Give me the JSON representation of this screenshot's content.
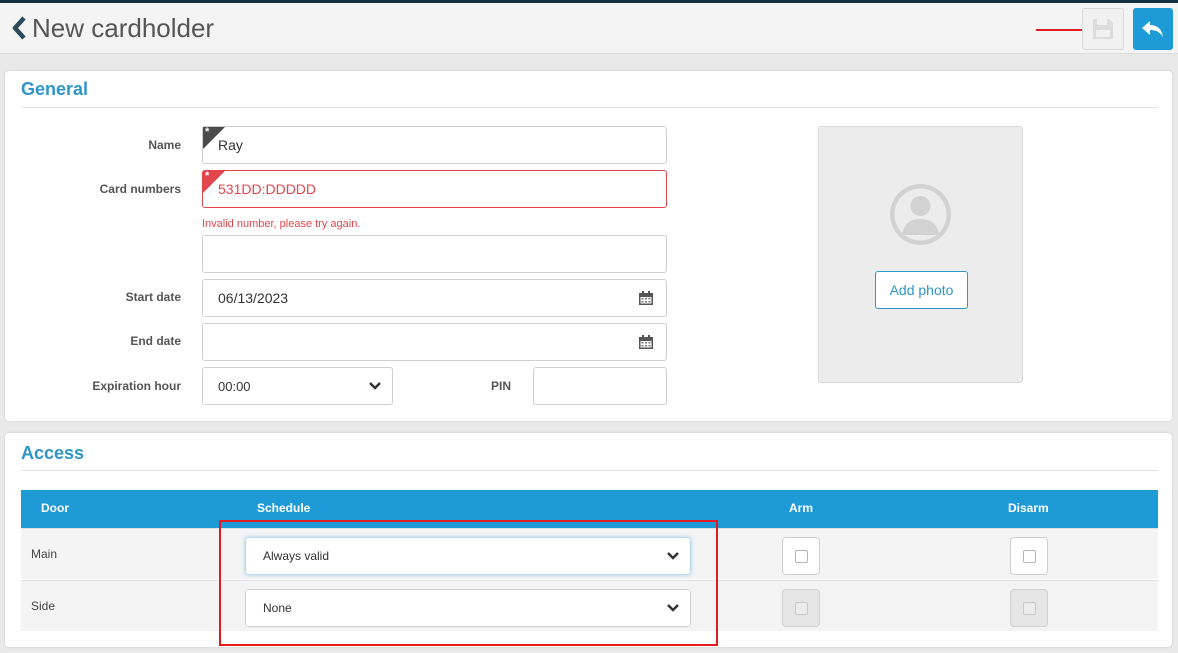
{
  "header": {
    "title": "New cardholder"
  },
  "general": {
    "section_title": "General",
    "name_label": "Name",
    "name_value": "Ray",
    "card_numbers_label": "Card numbers",
    "card_number_1": "531DD:DDDDD",
    "card_number_error": "Invalid number, please try again.",
    "card_number_2": "",
    "start_date_label": "Start date",
    "start_date_value": "06/13/2023",
    "end_date_label": "End date",
    "end_date_value": "",
    "expiration_hour_label": "Expiration hour",
    "expiration_hour_value": "00:00",
    "pin_label": "PIN",
    "pin_value": "",
    "add_photo_label": "Add photo"
  },
  "access": {
    "section_title": "Access",
    "columns": [
      "Door",
      "Schedule",
      "Arm",
      "Disarm"
    ],
    "rows": [
      {
        "door": "Main",
        "schedule": "Always valid",
        "arm": false,
        "disarm": false,
        "enabled": true
      },
      {
        "door": "Side",
        "schedule": "None",
        "arm": false,
        "disarm": false,
        "enabled": false
      }
    ]
  },
  "colors": {
    "accent": "#1e9ad6",
    "heading": "#2f96c8",
    "error": "#e0464b",
    "annotation": "#e21b23"
  },
  "icons": {
    "back": "chevron-left-icon",
    "save": "floppy-disk-icon",
    "return": "reply-arrow-icon",
    "calendar": "calendar-icon",
    "dropdown": "chevron-down-icon",
    "avatar": "user-avatar-icon"
  }
}
